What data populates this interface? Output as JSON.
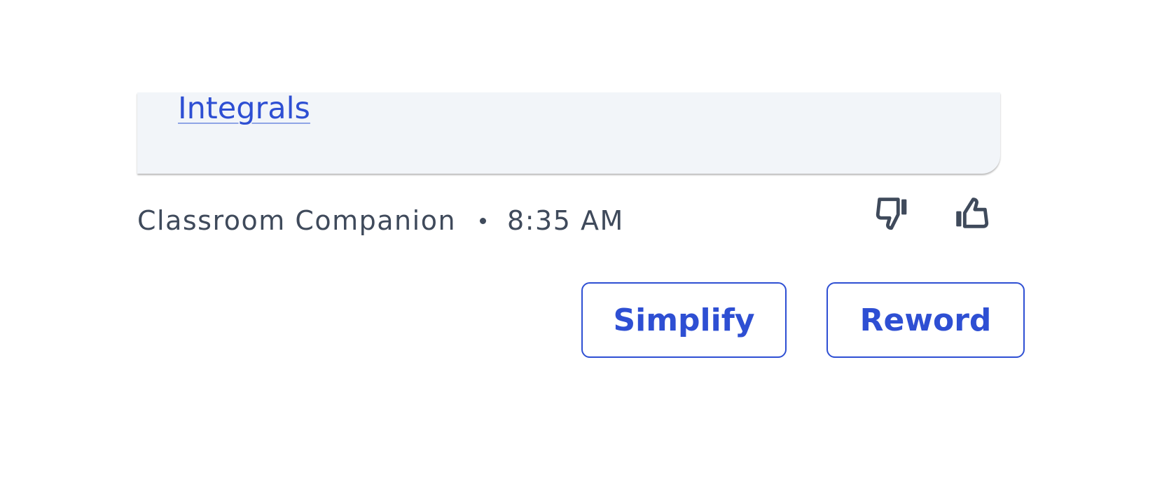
{
  "message": {
    "link_text": "Integrals"
  },
  "meta": {
    "sender": "Classroom Companion",
    "time": "8:35 AM"
  },
  "feedback": {
    "thumbs_down_icon": "thumbs-down-icon",
    "thumbs_up_icon": "thumbs-up-icon"
  },
  "actions": {
    "simplify_label": "Simplify",
    "reword_label": "Reword"
  },
  "colors": {
    "accent": "#2e4fd3",
    "card_background": "#f2f5f9",
    "meta_text": "#3f4a5b"
  }
}
